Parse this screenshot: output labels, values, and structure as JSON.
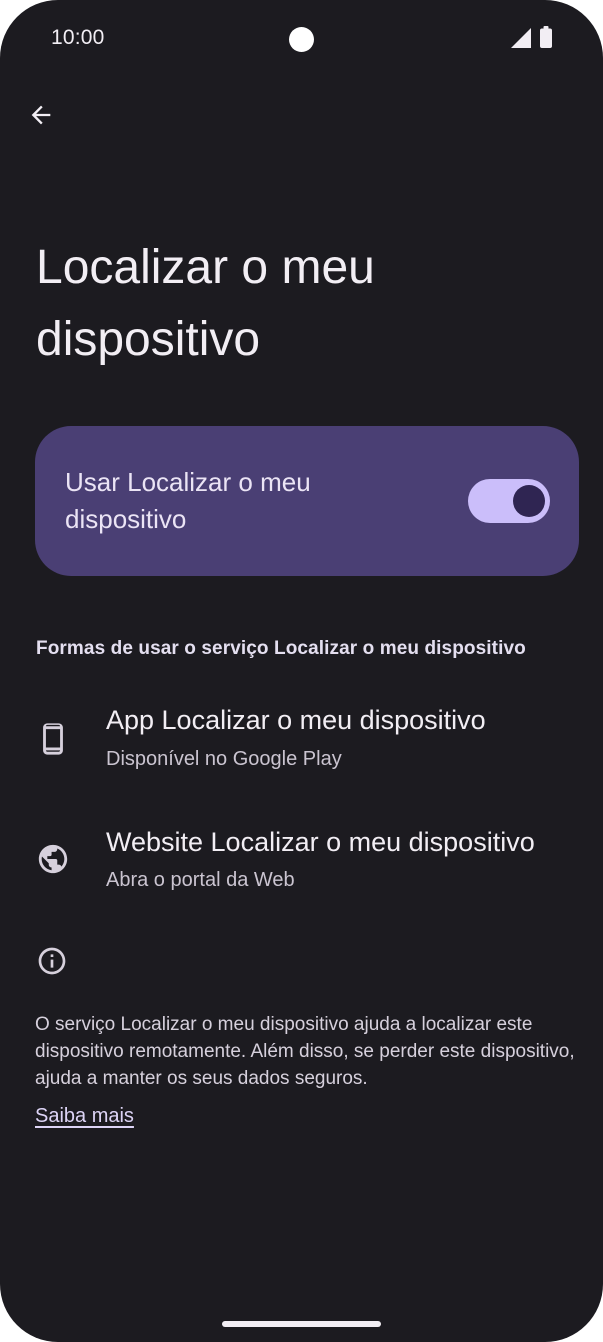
{
  "status_bar": {
    "time": "10:00",
    "icons": [
      "camera-cutout",
      "signal-icon",
      "battery-icon"
    ]
  },
  "header": {
    "back_icon": "arrow-back-icon",
    "title": "Localizar o meu dispositivo"
  },
  "main_toggle": {
    "label": "Usar Localizar o meu dispositivo",
    "enabled": true
  },
  "section": {
    "header": "Formas de usar o serviço Localizar o meu dispositivo",
    "items": [
      {
        "icon": "phone-icon",
        "title": "App Localizar o meu dispositivo",
        "subtitle": "Disponível no Google Play"
      },
      {
        "icon": "globe-icon",
        "title": "Website Localizar o meu dispositivo",
        "subtitle": "Abra o portal da Web"
      }
    ]
  },
  "footer": {
    "icon": "info-icon",
    "text": "O serviço Localizar o meu dispositivo ajuda a localizar este dispositivo remotamente. Além disso, se perder este dispositivo, ajuda a manter os seus dados seguros.",
    "link": "Saiba mais"
  },
  "colors": {
    "background": "#1c1b20",
    "card": "#4a3f74",
    "switch_track": "#cbbefa",
    "switch_thumb": "#2f2552",
    "text_primary": "#f2eef4",
    "text_secondary": "#cac4d0"
  }
}
